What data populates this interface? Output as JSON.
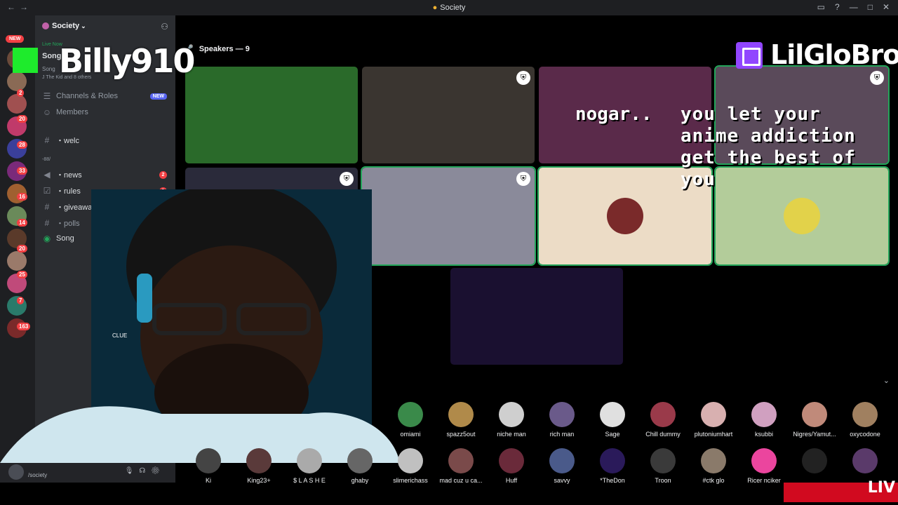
{
  "window": {
    "title": "Society"
  },
  "server": {
    "name": "Society"
  },
  "guild_badges": [
    "2",
    "2",
    "20",
    "28",
    "33",
    "16",
    "14",
    "20",
    "25",
    "7",
    "163"
  ],
  "guild_colors": [
    "#6b4a3a",
    "#8a6a55",
    "#a05050",
    "#c03a6a",
    "#3a3f9a",
    "#7a2a7a",
    "#a06030",
    "#6a8a5a",
    "#5a3a2a",
    "#9a7a6a",
    "#c04a7a",
    "#2a7a6a",
    "#7a2a2a"
  ],
  "live_now": {
    "tag": "Live Now",
    "channel": "Song",
    "subtitle": "Song",
    "participants": "J The Kid and 8 others"
  },
  "channels": [
    {
      "icon": "channels-roles-icon",
      "label": "Channels & Roles",
      "tag": "NEW"
    },
    {
      "icon": "members-icon",
      "label": "Members"
    },
    {
      "icon": "hash",
      "label": "・welc"
    },
    {
      "label": "・news",
      "badge": "2"
    },
    {
      "label": "・rules",
      "badge": "1"
    },
    {
      "label": "・giveaways"
    },
    {
      "label": "・polls"
    },
    {
      "label": "Song",
      "sub": "Song"
    }
  ],
  "category_marker": "-88/",
  "user": {
    "name": "",
    "status": "/society"
  },
  "stage": {
    "speakers_label": "Speakers — 9"
  },
  "overlays": {
    "twitch_name": "LilGloBro",
    "billy_name": "Billy910",
    "chat_message": "you let your anime addiction get the best of you",
    "nogar": "nogar..",
    "live": "LIV",
    "cam_tag": "CLUE"
  },
  "speaker_tiles": [
    {
      "name": "speaker-tile-1",
      "bg": "#2a6a2a"
    },
    {
      "name": "speaker-tile-2",
      "bg": "#3a3530"
    },
    {
      "name": "speaker-tile-3",
      "bg": "#5a2a4a"
    },
    {
      "name": "speaker-tile-4",
      "bg": "#5a4a5a"
    },
    {
      "name": "speaker-tile-5",
      "bg": "#2a2a3a"
    },
    {
      "name": "speaker-tile-6",
      "bg": "#8a8a9a"
    },
    {
      "name": "speaker-tile-7",
      "bg": "#ecdcc6"
    },
    {
      "name": "speaker-tile-8",
      "bg": "#b3cc9a"
    },
    {
      "name": "speaker-tile-9",
      "bg": "#1a1030"
    }
  ],
  "audience_row1": [
    {
      "name": "omiami",
      "color": "#3a8a4a"
    },
    {
      "name": "spazz5out",
      "color": "#b08a4a"
    },
    {
      "name": "niche man",
      "color": "#cfcfcf"
    },
    {
      "name": "rich man",
      "color": "#6a5a8a"
    },
    {
      "name": "Sage",
      "color": "#e0e0e0"
    },
    {
      "name": "Chill dummy",
      "color": "#9a3a4a"
    },
    {
      "name": "plutoniumhart",
      "color": "#d8b0b0"
    },
    {
      "name": "ksubbi",
      "color": "#d0a0c0"
    },
    {
      "name": "Nigres/Yamut...",
      "color": "#c08a7a"
    },
    {
      "name": "oxycodone",
      "color": "#a08060"
    }
  ],
  "audience_row2": [
    {
      "name": "Ki",
      "color": "#444"
    },
    {
      "name": "King23+",
      "color": "#5a3a3a"
    },
    {
      "name": "$ L A S H E",
      "color": "#aaa"
    },
    {
      "name": "ghaby",
      "color": "#666"
    },
    {
      "name": "slimerichass",
      "color": "#c0c0c0"
    },
    {
      "name": "mad cuz u ca...",
      "color": "#7a4a4a"
    },
    {
      "name": "Huff",
      "color": "#6a2a3a"
    },
    {
      "name": "savvy",
      "color": "#4a5a8a"
    },
    {
      "name": "*TheDon",
      "color": "#2a1a5a"
    },
    {
      "name": "Troon",
      "color": "#3a3a3a"
    },
    {
      "name": "#ctk glo",
      "color": "#8a7a6a"
    },
    {
      "name": "Ricer nciker",
      "color": "#eb459e"
    },
    {
      "name": "",
      "color": "#222"
    },
    {
      "name": "",
      "color": "#5a3a6a"
    }
  ]
}
